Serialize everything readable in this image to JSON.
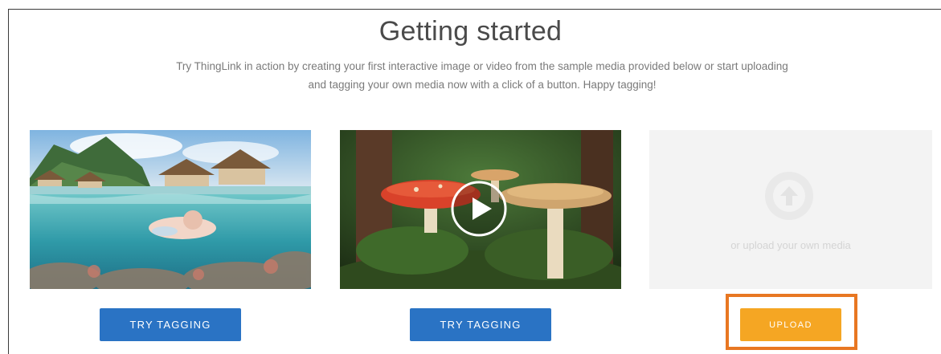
{
  "page": {
    "title": "Getting started",
    "description": "Try ThingLink in action by creating your first interactive image or video from the sample media provided below or start uploading and tagging your own media now with a click of a button. Happy tagging!"
  },
  "cards": [
    {
      "type": "image",
      "subject": "tropical-overwater-bungalows-snorkeler"
    },
    {
      "type": "video",
      "subject": "red-and-tan-mushrooms-forest",
      "icon": "play-icon"
    },
    {
      "type": "upload",
      "text": "or upload your own media",
      "icon": "upload-arrow-icon"
    }
  ],
  "buttons": {
    "try_tagging_1": "TRY TAGGING",
    "try_tagging_2": "TRY TAGGING",
    "upload": "UPLOAD"
  },
  "colors": {
    "primary_button": "#2a73c4",
    "upload_button": "#f5a623",
    "highlight_border": "#e87722",
    "upload_placeholder": "#f3f3f3"
  }
}
